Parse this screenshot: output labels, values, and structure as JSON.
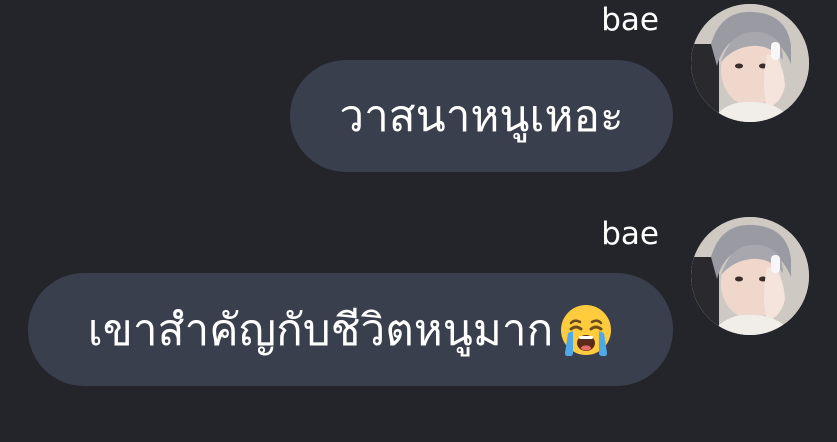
{
  "messages": [
    {
      "sender": "bae",
      "text": "วาสนาหนูเหอะ",
      "emoji": "",
      "avatar_icon": "profile-photo"
    },
    {
      "sender": "bae",
      "text": "เขาสำคัญกับชีวิตหนูมาก",
      "emoji": "loudly-crying-face",
      "avatar_icon": "profile-photo"
    }
  ],
  "colors": {
    "background": "#24252b",
    "bubble": "#3a3f4d",
    "text": "#ffffff",
    "emoji_face": "#ffcc3d",
    "emoji_tears": "#4fa9e8"
  }
}
